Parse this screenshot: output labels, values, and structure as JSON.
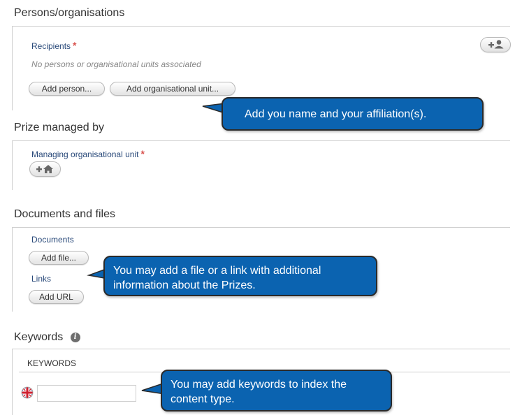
{
  "persons": {
    "title": "Persons/organisations",
    "recipients_label": "Recipients",
    "empty_note": "No persons or organisational units associated",
    "add_person": "Add person...",
    "add_org_unit": "Add organisational unit...",
    "add_recipient_icon": "add-person-icon"
  },
  "prize": {
    "title": "Prize managed by",
    "managing_label": "Managing organisational unit",
    "add_unit_icon": "add-home-icon"
  },
  "documents": {
    "title": "Documents and files",
    "documents_label": "Documents",
    "add_file": "Add file...",
    "links_label": "Links",
    "add_url": "Add URL"
  },
  "keywords": {
    "title": "Keywords",
    "subheading": "KEYWORDS",
    "input_value": "",
    "flag_icon": "uk-flag-icon"
  },
  "callouts": {
    "name": "Add you name and your affiliation(s).",
    "file_line1": "You may add a file or a link with additional",
    "file_line2": "information about the Prizes.",
    "kw_line1": "You may add keywords to index the",
    "kw_line2": "content type."
  },
  "colors": {
    "callout_bg": "#0b63b0",
    "label_blue": "#2a4a7a",
    "required_red": "#d9534f"
  }
}
